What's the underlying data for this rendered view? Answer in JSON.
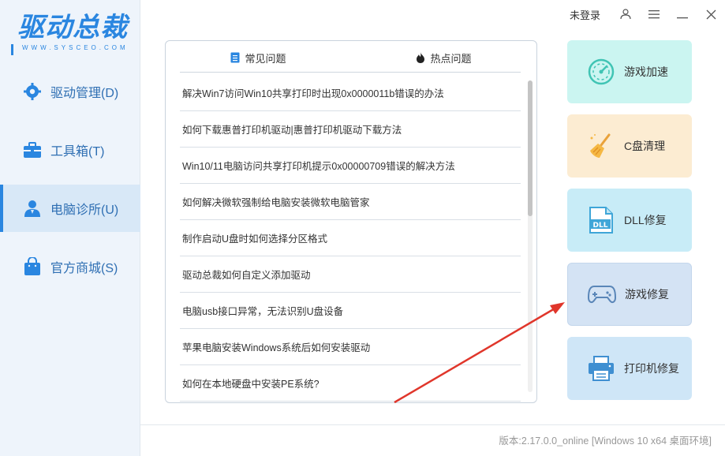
{
  "app": {
    "logo_text": "驱动总裁",
    "logo_sub": "WWW.SYSCEO.COM"
  },
  "topbar": {
    "login_text": "未登录"
  },
  "sidebar": {
    "items": [
      {
        "label": "驱动管理(D)",
        "icon": "gear-icon"
      },
      {
        "label": "工具箱(T)",
        "icon": "toolbox-icon"
      },
      {
        "label": "电脑诊所(U)",
        "icon": "doctor-icon",
        "active": true
      },
      {
        "label": "官方商城(S)",
        "icon": "shopping-bag-icon"
      }
    ]
  },
  "tabs": [
    {
      "label": "常见问题",
      "icon": "document-icon",
      "active": true
    },
    {
      "label": "热点问题",
      "icon": "flame-icon"
    }
  ],
  "questions": [
    "解决Win7访问Win10共享打印时出现0x0000011b错误的办法",
    "如何下载惠普打印机驱动|惠普打印机驱动下载方法",
    "Win10/11电脑访问共享打印机提示0x00000709错误的解决方法",
    "如何解决微软强制给电脑安装微软电脑管家",
    "制作启动U盘时如何选择分区格式",
    "驱动总裁如何自定义添加驱动",
    "电脑usb接口异常，无法识别U盘设备",
    "苹果电脑安装Windows系统后如何安装驱动",
    "如何在本地硬盘中安装PE系统?"
  ],
  "tools": [
    {
      "label": "游戏加速",
      "icon": "speedometer-icon",
      "bg": "#cbf5f1"
    },
    {
      "label": "C盘清理",
      "icon": "broom-icon",
      "bg": "#fcecd2"
    },
    {
      "label": "DLL修复",
      "icon": "dll-file-icon",
      "bg": "#c8ecf7"
    },
    {
      "label": "游戏修复",
      "icon": "gamepad-icon",
      "bg": "#d4e3f4"
    },
    {
      "label": "打印机修复",
      "icon": "printer-icon",
      "bg": "#cfe6f7"
    }
  ],
  "footer": {
    "version_text": "版本:2.17.0.0_online [Windows 10 x64 桌面环境]"
  },
  "colors": {
    "accent": "#2a86e0",
    "sidebar_bg": "#eef4fb",
    "sidebar_active": "#d8e8f7",
    "annotation_arrow": "#e0362b"
  }
}
